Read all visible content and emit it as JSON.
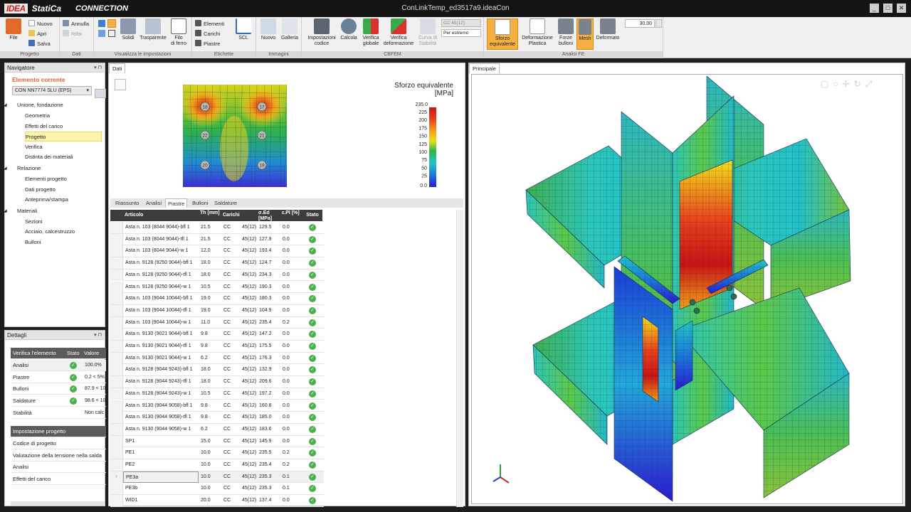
{
  "app": {
    "logo_idea": "IDEA",
    "logo_statica": "StatiCa",
    "logo_product": "CONNECTION",
    "window_title": "ConLinkTemp_ed3517a9.ideaCon",
    "win_minimize": "_",
    "win_restore": "□",
    "win_close": "✕"
  },
  "ribbon": {
    "progetto": {
      "label": "Progetto",
      "file": "File",
      "nuovo": "Nuovo",
      "apri": "Apri",
      "salva": "Salva"
    },
    "dati": {
      "label": "Dati",
      "annulla": "Annulla",
      "rifai": "Rifai"
    },
    "visualizza": {
      "label": "Visualizza le impostazioni",
      "solidi": "Solidi",
      "trasparente": "Trasparente",
      "filo": "Filo",
      "filo2": "di ferro"
    },
    "etichette": {
      "label": "Etichette",
      "elementi": "Elementi",
      "carichi": "Carichi",
      "piastre": "Piastre",
      "scl": "SCL"
    },
    "immagini": {
      "label": "Immagini",
      "nuovo": "Nuovo",
      "galleria": "Galleria"
    },
    "cbfem": {
      "label": "CBFEM",
      "impostazioni": "Impostazioni",
      "codice": "codice",
      "calcola": "Calcola",
      "verifica": "Verifica",
      "globale": "globale",
      "verifica2": "Verifica",
      "deformazione": "deformazione",
      "curva": "Curva di",
      "stabilita": "Stabilità",
      "cc_combo": "CC  45(12)",
      "estremo": "Per estremo"
    },
    "analisife": {
      "label": "Analisi FE",
      "sforzo": "Sforzo",
      "equivalente": "equivalente",
      "deform": "Deformazione",
      "plastica": "Plastica",
      "forze": "Forze",
      "bulloni": "bulloni",
      "mesh": "Mesh",
      "deformato": "Deformato",
      "scale": "30.00"
    }
  },
  "navigator": {
    "title": "Navigatore",
    "current_label": "Elemento corrente",
    "current_value": "CON NN7774 SLU (EPS)",
    "groups": [
      {
        "label": "Unione, fondazione",
        "items": [
          "Geometria",
          "Effetti del carico",
          "Progetto",
          "Verifica",
          "Distinta dei materiali"
        ]
      },
      {
        "label": "Relazione",
        "items": [
          "Elementi progetto",
          "Dati progetto",
          "Anteprima/stampa"
        ]
      },
      {
        "label": "Materiali",
        "items": [
          "Sezioni",
          "Acciaio, calcestruzzo",
          "Bulloni"
        ]
      }
    ]
  },
  "details": {
    "title": "Dettagli",
    "headers": [
      "Verifica l'elemento",
      "Stato",
      "Valore"
    ],
    "rows": [
      {
        "name": "Analisi",
        "ok": true,
        "value": "100.0%"
      },
      {
        "name": "Piastre",
        "ok": true,
        "value": "0.2 < 5%"
      },
      {
        "name": "Bulloni",
        "ok": true,
        "value": "87.9 < 10"
      },
      {
        "name": "Saldature",
        "ok": true,
        "value": "98.6 < 10"
      },
      {
        "name": "Stabilità",
        "ok": false,
        "value": "Non calc"
      }
    ],
    "settings_title": "Impostazione progetto",
    "settings": [
      "Codice di progetto",
      "Valutazione della tensione nella salda",
      "Analisi",
      "Effetti del carico"
    ]
  },
  "dati": {
    "tab": "Dati",
    "legend_title1": "Sforzo equivalente",
    "legend_title2": "[MPa]",
    "legend_top": "235.0",
    "legend_ticks": [
      "225",
      "200",
      "175",
      "150",
      "125",
      "100",
      "75",
      "50",
      "25",
      "0.0"
    ],
    "bolt_labels": [
      "18",
      "17",
      "22",
      "21",
      "20",
      "19"
    ],
    "subtabs": [
      "Riassunto",
      "Analisi",
      "Piastre",
      "Bulloni",
      "Saldature"
    ],
    "active_subtab": 2,
    "columns": [
      "Articolo",
      "Th [mm]",
      "Carichi",
      "",
      "σ.Ed [MPa]",
      "ε.Pl [%]",
      "Stato"
    ],
    "rows": [
      [
        "Asta n. 103 (8044 9044)-bfl 1",
        "21.5",
        "CC",
        "45(12)",
        "129.5",
        "0.0"
      ],
      [
        "Asta n. 103 (8044 9044)-tfl 1",
        "21.5",
        "CC",
        "45(12)",
        "127.9",
        "0.0"
      ],
      [
        "Asta n. 103 (8044 9044)-w 1",
        "12.0",
        "CC",
        "45(12)",
        "193.4",
        "0.0"
      ],
      [
        "Asta n. 9128 (9250 9044)-bfl 1",
        "18.0",
        "CC",
        "45(12)",
        "124.7",
        "0.0"
      ],
      [
        "Asta n. 9128 (9250 9044)-tfl 1",
        "18.0",
        "CC",
        "45(12)",
        "234.3",
        "0.0"
      ],
      [
        "Asta n. 9128 (9250 9044)-w 1",
        "10.5",
        "CC",
        "45(12)",
        "190.3",
        "0.0"
      ],
      [
        "Asta n. 103 (9044 10044)-bfl 1",
        "19.0",
        "CC",
        "45(12)",
        "180.3",
        "0.0"
      ],
      [
        "Asta n. 103 (9044 10044)-tfl 1",
        "19.0",
        "CC",
        "45(12)",
        "104.9",
        "0.0"
      ],
      [
        "Asta n. 103 (9044 10044)-w 1",
        "11.0",
        "CC",
        "45(12)",
        "235.4",
        "0.2"
      ],
      [
        "Asta n. 9130 (9021 9044)-bfl 1",
        "9.8",
        "CC",
        "45(12)",
        "147.2",
        "0.0"
      ],
      [
        "Asta n. 9130 (9021 9044)-tfl 1",
        "9.8",
        "CC",
        "45(12)",
        "175.5",
        "0.0"
      ],
      [
        "Asta n. 9130 (9021 9044)-w 1",
        "6.2",
        "CC",
        "45(12)",
        "176.3",
        "0.0"
      ],
      [
        "Asta n. 9128 (9044 9243)-bfl 1",
        "18.0",
        "CC",
        "45(12)",
        "132.9",
        "0.0"
      ],
      [
        "Asta n. 9128 (9044 9243)-tfl 1",
        "18.0",
        "CC",
        "45(12)",
        "209.6",
        "0.0"
      ],
      [
        "Asta n. 9128 (9044 9243)-w 1",
        "10.5",
        "CC",
        "45(12)",
        "197.2",
        "0.0"
      ],
      [
        "Asta n. 9130 (9044 9058)-bfl 1",
        "9.8",
        "CC",
        "45(12)",
        "160.8",
        "0.0"
      ],
      [
        "Asta n. 9130 (9044 9058)-tfl 1",
        "9.8",
        "CC",
        "45(12)",
        "185.0",
        "0.0"
      ],
      [
        "Asta n. 9130 (9044 9058)-w 1",
        "6.2",
        "CC",
        "45(12)",
        "183.6",
        "0.0"
      ],
      [
        "SP1",
        "15.0",
        "CC",
        "45(12)",
        "145.9",
        "0.0"
      ],
      [
        "PE1",
        "10.0",
        "CC",
        "45(12)",
        "235.5",
        "0.2"
      ],
      [
        "PE2",
        "10.0",
        "CC",
        "45(12)",
        "235.4",
        "0.2"
      ],
      [
        "PE3a",
        "10.0",
        "CC",
        "45(12)",
        "235.3",
        "0.1"
      ],
      [
        "PE3b",
        "10.0",
        "CC",
        "45(12)",
        "235.3",
        "0.1"
      ],
      [
        "WID1",
        "20.0",
        "CC",
        "45(12)",
        "137.4",
        "0.0"
      ]
    ],
    "selected_row": 21
  },
  "principale": {
    "tab": "Principale"
  },
  "colors": {
    "accent": "#f5b041",
    "ok": "#4cae4c",
    "title_orange": "#e2622a"
  }
}
